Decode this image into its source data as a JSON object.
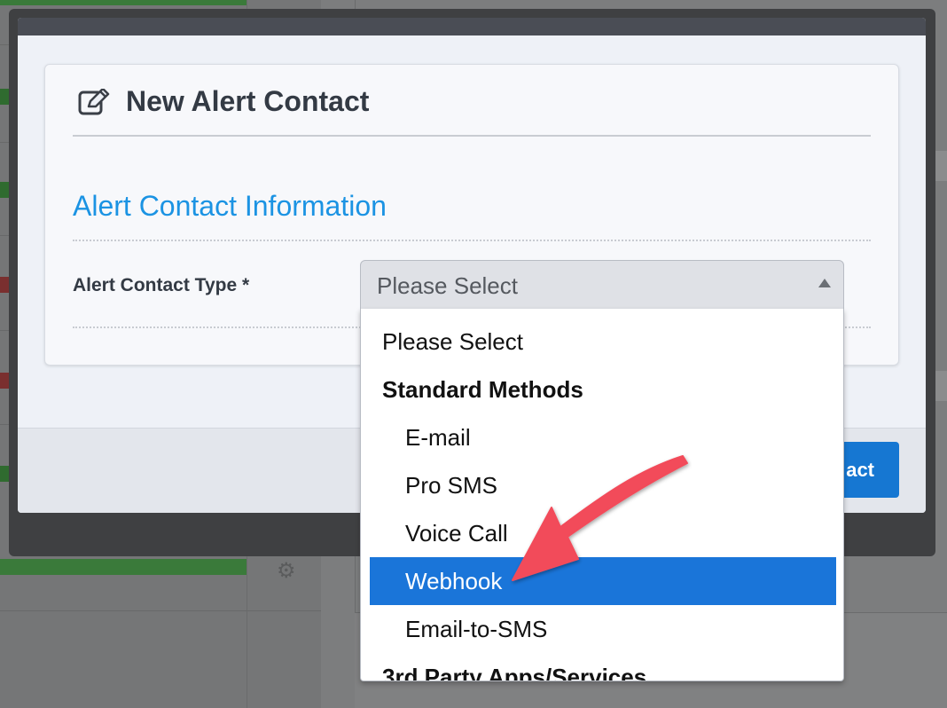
{
  "modal": {
    "title": "New Alert Contact",
    "section_title": "Alert Contact Information",
    "field_label": "Alert Contact Type *",
    "select_value": "Please Select",
    "submit_label_partial": "act"
  },
  "dropdown": {
    "options": [
      {
        "label": "Please Select",
        "kind": "top"
      },
      {
        "label": "Standard Methods",
        "kind": "group"
      },
      {
        "label": "E-mail",
        "kind": "child"
      },
      {
        "label": "Pro SMS",
        "kind": "child"
      },
      {
        "label": "Voice Call",
        "kind": "child"
      },
      {
        "label": "Webhook",
        "kind": "child",
        "selected": true
      },
      {
        "label": "Email-to-SMS",
        "kind": "child"
      },
      {
        "label": "3rd Party Apps/Services",
        "kind": "group"
      }
    ]
  },
  "colors": {
    "accent": "#1b93e3",
    "selected": "#1a75d9",
    "annotation_arrow": "#f24b5a"
  },
  "icons": {
    "title_icon": "edit-icon",
    "select_icon": "caret-up-icon",
    "background_icon": "gear-icon"
  }
}
